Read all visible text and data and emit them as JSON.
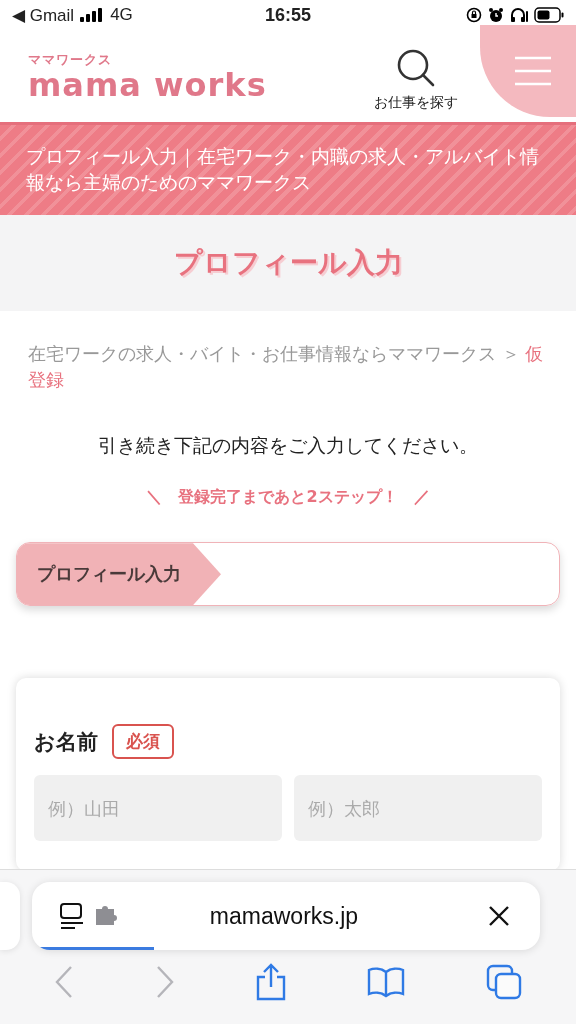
{
  "status_bar": {
    "back_app": "◀ Gmail",
    "network": "4G",
    "time": "16:55"
  },
  "header": {
    "logo_kana": "ママワークス",
    "logo": "mama works",
    "search_label": "お仕事を探す"
  },
  "banner": {
    "text": "プロフィール入力｜在宅ワーク・内職の求人・アルバイト情報なら主婦のためのママワークス"
  },
  "page_title": "プロフィール入力",
  "breadcrumb": [
    {
      "label": "在宅ワークの求人・バイト・お仕事情報ならママワークス",
      "current": false
    },
    {
      "label": "仮登録",
      "current": true
    }
  ],
  "breadcrumb_separator": "＞",
  "instruction": "引き続き下記の内容をご入力してください。",
  "step_note": {
    "left": "＼",
    "text": "登録完了まであと2ステップ！",
    "right": "／"
  },
  "steps": [
    {
      "label": "プロフィール入力",
      "selected": true
    }
  ],
  "form": {
    "fields": [
      {
        "label": "お名前",
        "required": true,
        "required_label": "必須",
        "inputs": [
          {
            "placeholder": "例）山田"
          },
          {
            "placeholder": "例）太郎"
          }
        ]
      }
    ]
  },
  "browser": {
    "url": "mamaworks.jp",
    "progress": {
      "level": 0.24
    },
    "back_disabled": true,
    "forward_disabled": true
  }
}
